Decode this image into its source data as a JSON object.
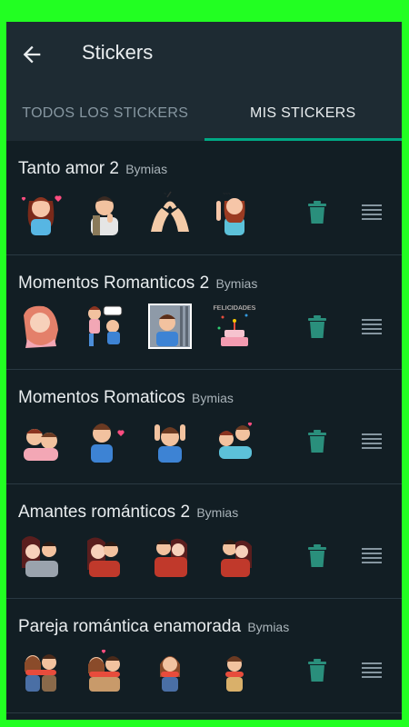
{
  "header": {
    "title": "Stickers"
  },
  "tabs": [
    {
      "label": "TODOS LOS STICKERS"
    },
    {
      "label": "MIS STICKERS"
    }
  ],
  "packs": [
    {
      "name": "Tanto amor 2",
      "author": "Bymias"
    },
    {
      "name": "Momentos Romanticos 2",
      "author": "Bymias"
    },
    {
      "name": "Momentos Romaticos",
      "author": "Bymias"
    },
    {
      "name": "Amantes románticos 2",
      "author": "Bymias"
    },
    {
      "name": "Pareja romántica enamorada",
      "author": "Bymias"
    }
  ],
  "stickers": {
    "pack1": [
      "FELICIDADES"
    ]
  },
  "colors": {
    "accent": "#00a884",
    "trash": "#2a8f7c",
    "frame": "#22ff22",
    "background": "#121e24",
    "appbar": "#1e2b33"
  },
  "icons": {
    "back": "arrow-back-icon",
    "delete": "trash-icon",
    "reorder": "drag-handle-icon"
  }
}
